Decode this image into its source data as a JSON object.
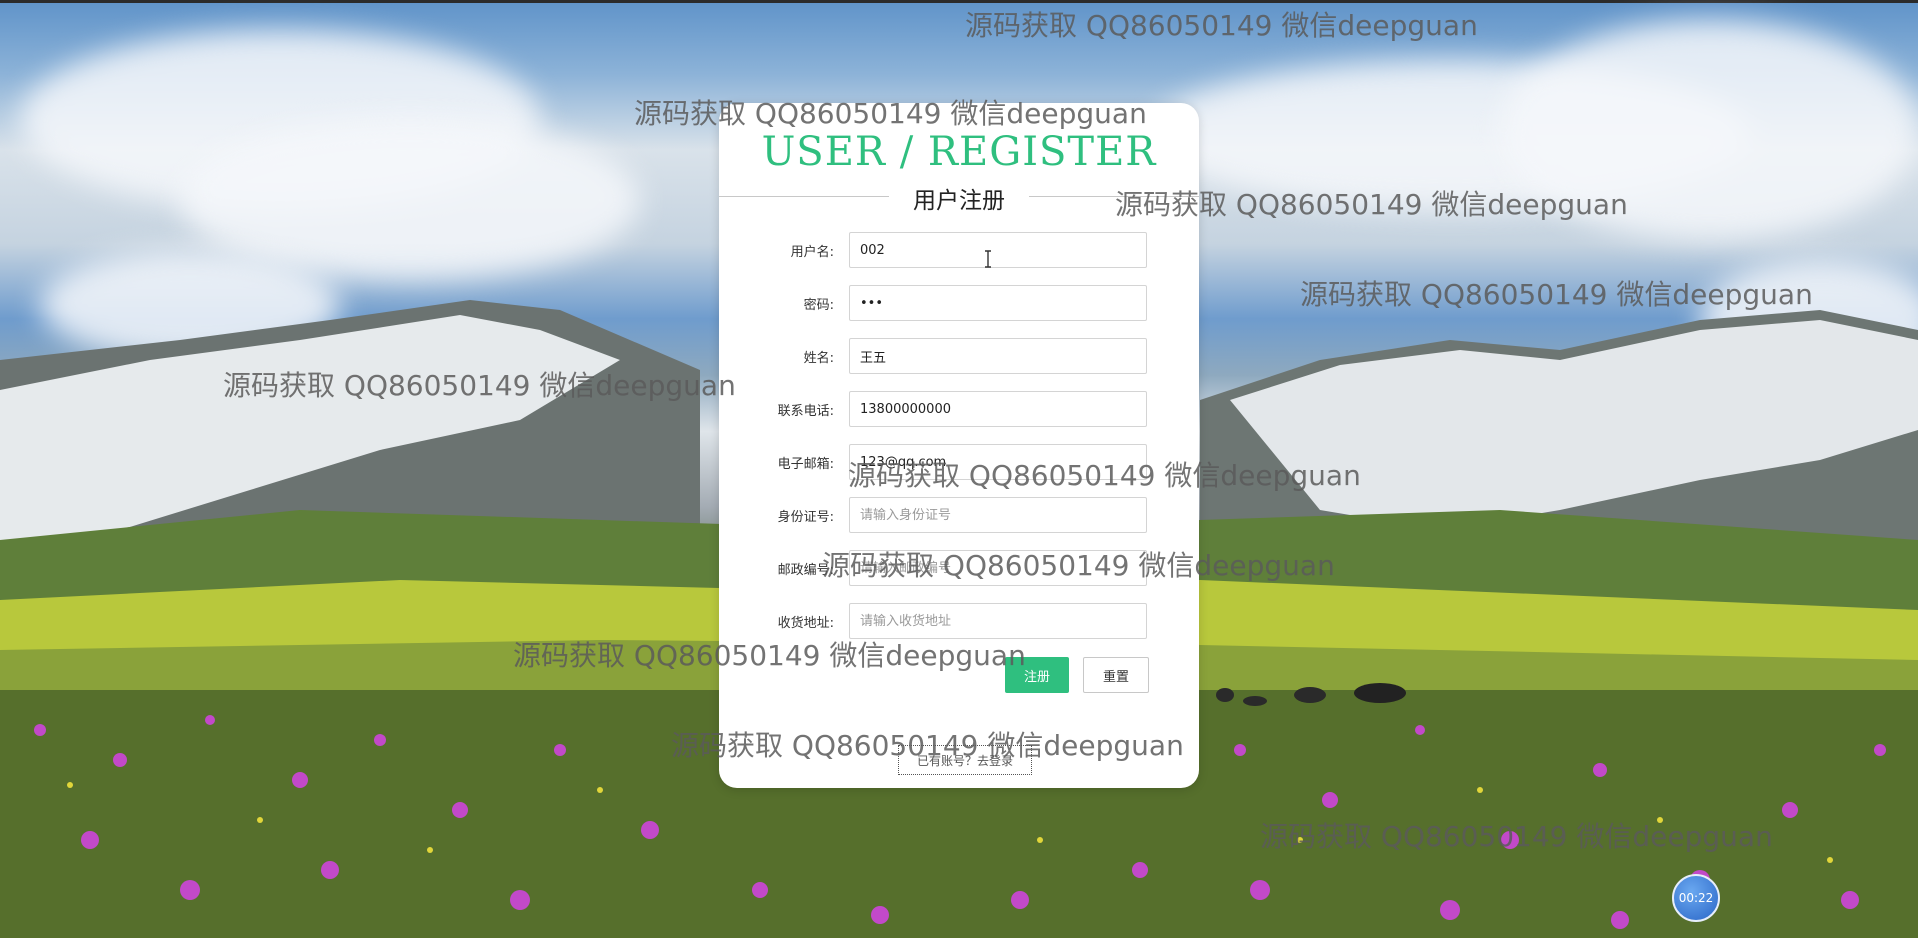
{
  "card": {
    "title": "USER / REGISTER",
    "subtitle": "用户注册"
  },
  "form": {
    "fields": [
      {
        "label": "用户名:",
        "value": "002",
        "placeholder": ""
      },
      {
        "label": "密码:",
        "value": "•••",
        "placeholder": ""
      },
      {
        "label": "姓名:",
        "value": "王五",
        "placeholder": ""
      },
      {
        "label": "联系电话:",
        "value": "13800000000",
        "placeholder": ""
      },
      {
        "label": "电子邮箱:",
        "value": "123@qq.com",
        "placeholder": ""
      },
      {
        "label": "身份证号:",
        "value": "",
        "placeholder": "请输入身份证号"
      },
      {
        "label": "邮政编号:",
        "value": "",
        "placeholder": "请输入邮政编号"
      },
      {
        "label": "收货地址:",
        "value": "",
        "placeholder": "请输入收货地址"
      }
    ],
    "register_label": "注册",
    "reset_label": "重置",
    "login_link": "已有账号？去登录"
  },
  "watermark": "源码获取 QQ86050149 微信deepguan",
  "timer": "00:22",
  "colors": {
    "accent": "#2fbf7f",
    "timer": "#2a66c7"
  }
}
